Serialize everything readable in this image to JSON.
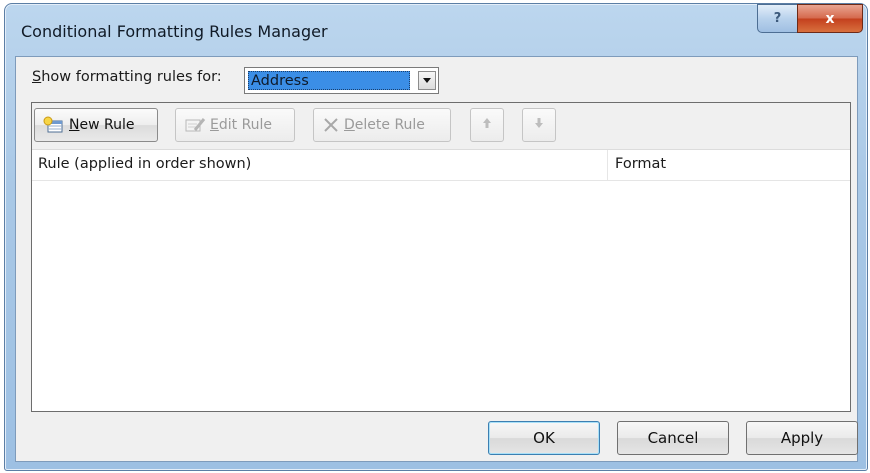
{
  "window": {
    "title": "Conditional Formatting Rules Manager",
    "help_glyph": "?",
    "close_glyph": "x"
  },
  "show_rules": {
    "label": "Show formatting rules for:",
    "selected": "Address"
  },
  "toolbar": {
    "new_rule": "New Rule",
    "edit_rule": "Edit Rule",
    "delete_rule": "Delete Rule"
  },
  "rules_list": {
    "columns": [
      "Rule (applied in order shown)",
      "Format"
    ],
    "rows": []
  },
  "buttons": {
    "ok": "OK",
    "cancel": "Cancel",
    "apply": "Apply"
  }
}
